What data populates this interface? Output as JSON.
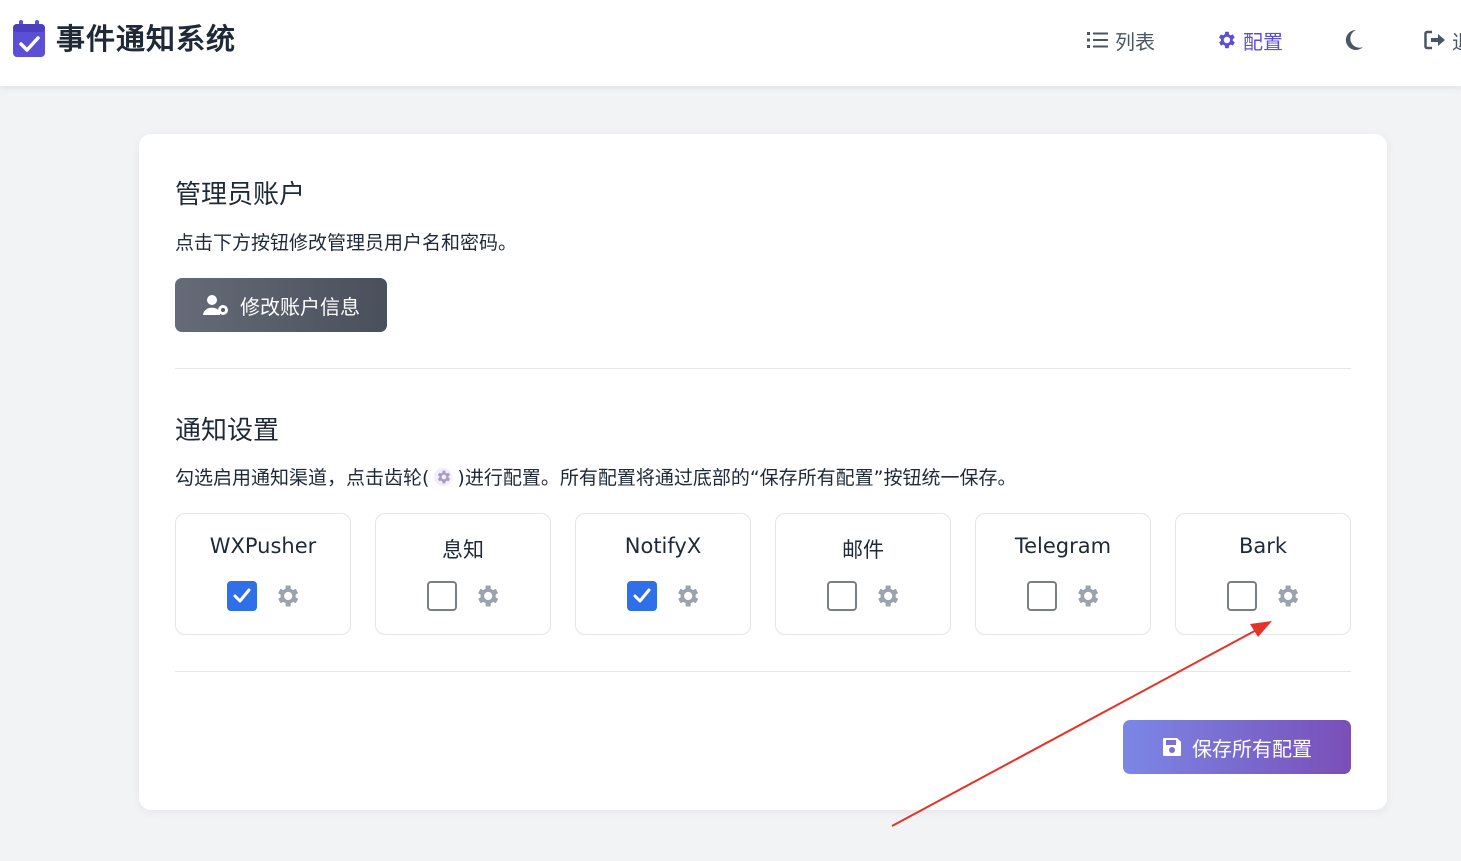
{
  "header": {
    "app_title": "事件通知系统",
    "app_icon": "calendar-check-icon",
    "nav": {
      "list_label": "列表",
      "config_label": "配置",
      "logout_label": "退"
    }
  },
  "admin": {
    "title": "管理员账户",
    "description": "点击下方按钮修改管理员用户名和密码。",
    "button_label": "修改账户信息"
  },
  "notify": {
    "title": "通知设置",
    "description_before": "勾选启用通知渠道，点击齿轮(",
    "description_after": ")进行配置。所有配置将通过底部的“保存所有配置”按钮统一保存。",
    "channels": [
      {
        "name": "WXPusher",
        "checked": true
      },
      {
        "name": "息知",
        "checked": false
      },
      {
        "name": "NotifyX",
        "checked": true
      },
      {
        "name": "邮件",
        "checked": false
      },
      {
        "name": "Telegram",
        "checked": false
      },
      {
        "name": "Bark",
        "checked": false
      }
    ]
  },
  "save_button_label": "保存所有配置",
  "colors": {
    "accent": "#5b4fd6",
    "checkbox_checked": "#2f6fe8",
    "annotation_arrow": "#e5332a"
  }
}
